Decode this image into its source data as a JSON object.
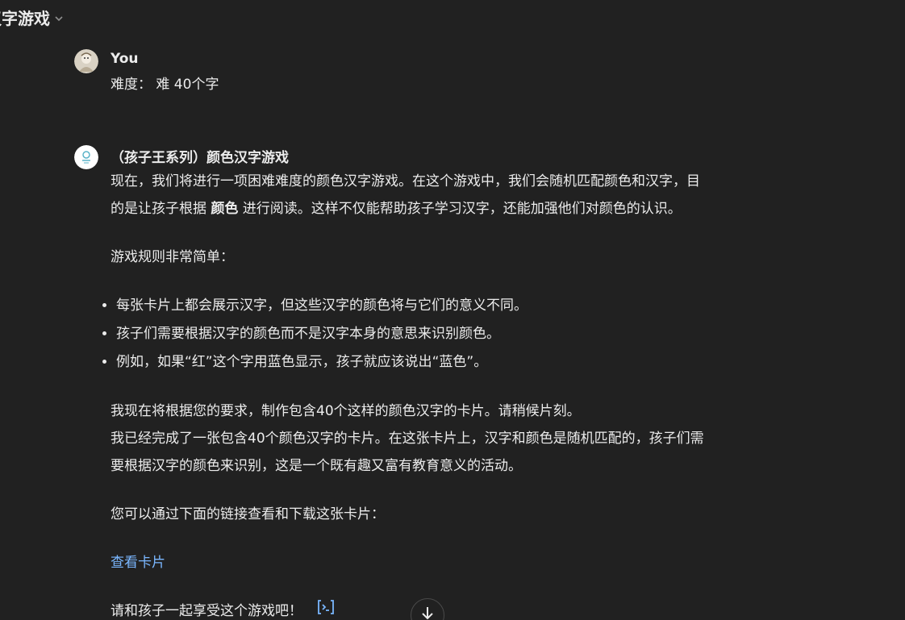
{
  "header": {
    "title": "汉字游戏",
    "title_visible": "汉字游戏",
    "dropdown_icon": "chevron-down-icon"
  },
  "user_message": {
    "author": "You",
    "text": "难度： 难  40个字"
  },
  "assistant_message": {
    "author": "（孩子王系列）颜色汉字游戏",
    "intro_line1": "现在，我们将进行一项困难难度的颜色汉字游戏。在这个游戏中，我们会随机匹配颜色和汉字，目",
    "intro_line2_pre": "的是让孩子根据 ",
    "intro_line2_bold": "颜色",
    "intro_line2_post": " 进行阅读。这样不仅能帮助孩子学习汉字，还能加强他们对颜色的认识。",
    "rules_heading": "游戏规则非常简单：",
    "rules": [
      "每张卡片上都会展示汉字，但这些汉字的颜色将与它们的意义不同。",
      "孩子们需要根据汉字的颜色而不是汉字本身的意思来识别颜色。",
      "例如，如果“红”这个字用蓝色显示，孩子就应该说出“蓝色”。"
    ],
    "making_line": "我现在将根据您的要求，制作包含40个这样的颜色汉字的卡片。请稍候片刻。",
    "done_line1": "我已经完成了一张包含40个颜色汉字的卡片。在这张卡片上，汉字和颜色是随机匹配的，孩子们需",
    "done_line2": "要根据汉字的颜色来识别，这是一个既有趣又富有教育意义的活动。",
    "link_intro": "您可以通过下面的链接查看和下载这张卡片：",
    "link_text": "查看卡片",
    "closing": "请和孩子一起享受这个游戏吧！",
    "code_icon": "code-interpreter-icon"
  },
  "scroll_down": {
    "icon": "arrow-down-icon"
  },
  "colors": {
    "background": "#212121",
    "text": "#ececec",
    "link": "#7ab7ff",
    "muted": "#8e8e8e"
  }
}
